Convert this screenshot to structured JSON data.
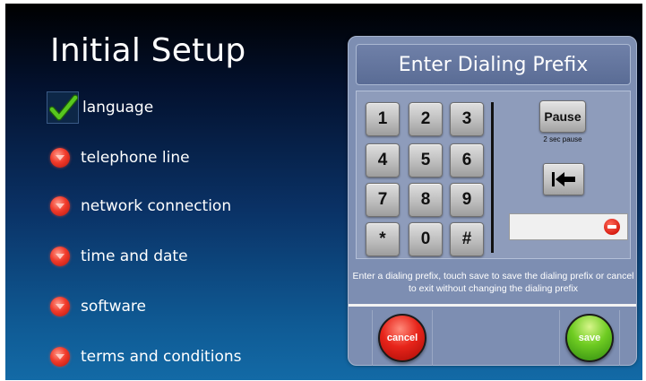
{
  "screen": {
    "title": "Initial Setup"
  },
  "steps": [
    {
      "label": "language",
      "status": "done",
      "icon": "checkmark-icon"
    },
    {
      "label": "telephone line",
      "status": "pending",
      "icon": "red-status-icon"
    },
    {
      "label": "network connection",
      "status": "pending",
      "icon": "red-status-icon"
    },
    {
      "label": "time and date",
      "status": "pending",
      "icon": "red-status-icon"
    },
    {
      "label": "software",
      "status": "pending",
      "icon": "red-status-icon"
    },
    {
      "label": "terms and conditions",
      "status": "pending",
      "icon": "red-status-icon"
    }
  ],
  "dialog": {
    "title": "Enter Dialing Prefix",
    "keys": [
      "1",
      "2",
      "3",
      "4",
      "5",
      "6",
      "7",
      "8",
      "9",
      "*",
      "0",
      "#"
    ],
    "pause_label": "Pause",
    "pause_caption": "2 sec pause",
    "backspace_icon": "backspace-arrow-icon",
    "prefix_value": "",
    "clear_icon": "clear-minus-icon",
    "instructions": "Enter a dialing prefix, touch save to save the dialing prefix or cancel to exit without changing the dialing prefix",
    "cancel_label": "cancel",
    "save_label": "save"
  },
  "colors": {
    "done": "#4fc21c",
    "pending": "#e7241a",
    "save": "#6fcc22",
    "cancel": "#e7241a"
  }
}
